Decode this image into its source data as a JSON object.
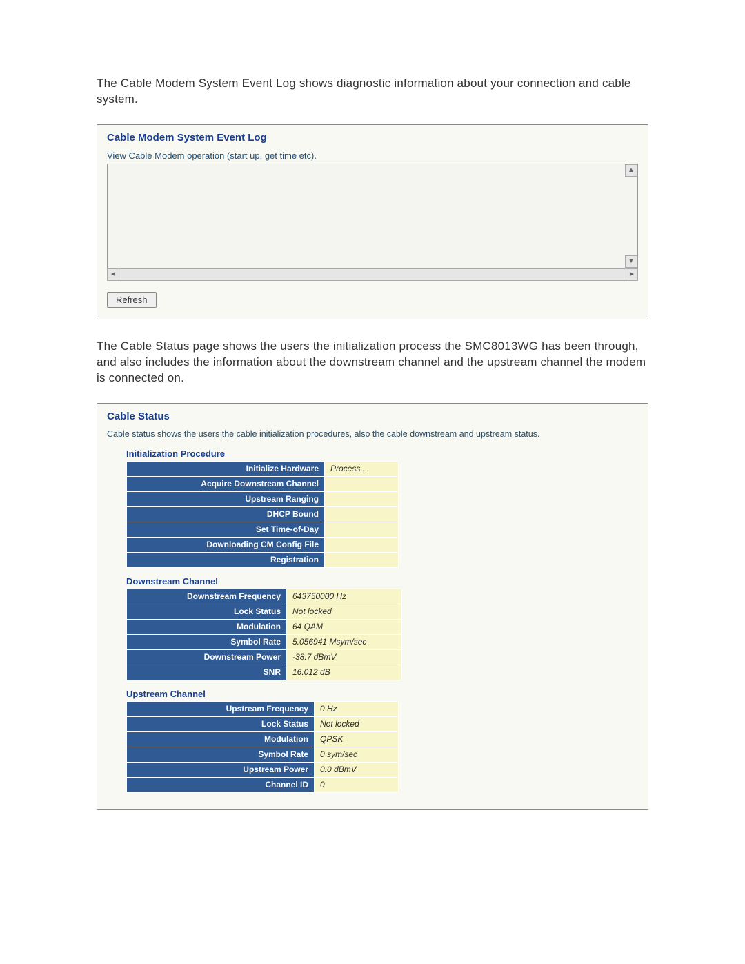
{
  "intro1": "The Cable Modem System Event Log shows diagnostic information about your connection and cable system.",
  "event_log": {
    "title": "Cable Modem System Event Log",
    "subtitle": "View Cable Modem operation (start up, get time etc).",
    "refresh": "Refresh"
  },
  "intro2": "The Cable Status page shows the users the initialization process the SMC8013WG has been through, and also includes the information about the downstream channel and the upstream channel the modem is connected on.",
  "cable_status": {
    "title": "Cable Status",
    "desc": "Cable status shows the users the cable initialization procedures, also the cable downstream and upstream status.",
    "init_header": "Initialization Procedure",
    "init_rows": [
      {
        "label": "Initialize Hardware",
        "value": "Process..."
      },
      {
        "label": "Acquire Downstream Channel",
        "value": ""
      },
      {
        "label": "Upstream Ranging",
        "value": ""
      },
      {
        "label": "DHCP Bound",
        "value": ""
      },
      {
        "label": "Set Time-of-Day",
        "value": ""
      },
      {
        "label": "Downloading CM Config File",
        "value": ""
      },
      {
        "label": "Registration",
        "value": ""
      }
    ],
    "down_header": "Downstream Channel",
    "down_rows": [
      {
        "label": "Downstream Frequency",
        "value": "643750000 Hz"
      },
      {
        "label": "Lock Status",
        "value": "Not locked"
      },
      {
        "label": "Modulation",
        "value": "64 QAM"
      },
      {
        "label": "Symbol Rate",
        "value": "5.056941 Msym/sec"
      },
      {
        "label": "Downstream Power",
        "value": "-38.7 dBmV"
      },
      {
        "label": "SNR",
        "value": "16.012 dB"
      }
    ],
    "up_header": "Upstream Channel",
    "up_rows": [
      {
        "label": "Upstream Frequency",
        "value": "0 Hz"
      },
      {
        "label": "Lock Status",
        "value": "Not locked"
      },
      {
        "label": "Modulation",
        "value": "QPSK"
      },
      {
        "label": "Symbol Rate",
        "value": "0 sym/sec"
      },
      {
        "label": "Upstream Power",
        "value": "0.0 dBmV"
      },
      {
        "label": "Channel ID",
        "value": "0"
      }
    ]
  }
}
